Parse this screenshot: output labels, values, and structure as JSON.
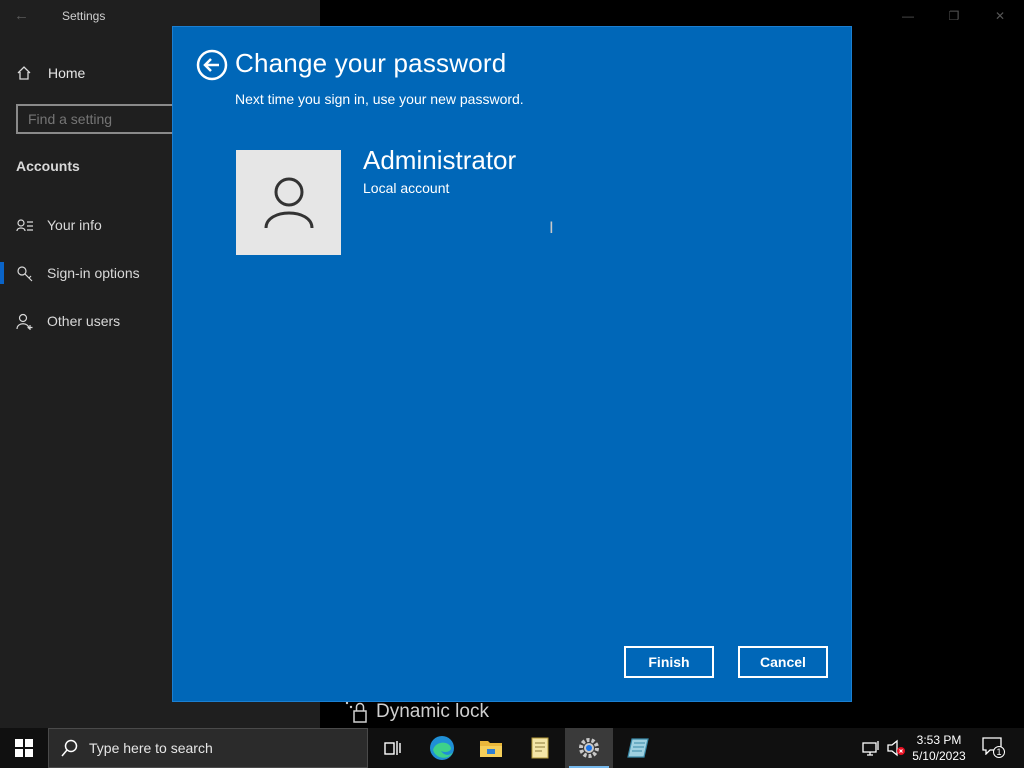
{
  "window": {
    "title": "Settings",
    "controls": [
      "minimize-icon",
      "maximize-icon",
      "close-icon"
    ]
  },
  "sidebar": {
    "home_label": "Home",
    "search_placeholder": "Find a setting",
    "section": "Accounts",
    "items": [
      {
        "label": "Your info",
        "icon": "person-card-icon",
        "selected": false
      },
      {
        "label": "Sign-in options",
        "icon": "key-icon",
        "selected": true
      },
      {
        "label": "Other users",
        "icon": "person-add-icon",
        "selected": false
      }
    ]
  },
  "background_content": {
    "dynamic_lock_label": "Dynamic lock"
  },
  "dialog": {
    "title": "Change your password",
    "subtitle": "Next time you sign in, use your new password.",
    "account_name": "Administrator",
    "account_type": "Local account",
    "finish_label": "Finish",
    "cancel_label": "Cancel"
  },
  "taskbar": {
    "search_placeholder": "Type here to search",
    "apps": [
      "task-view-icon",
      "edge-icon",
      "file-explorer-icon",
      "notepad-icon",
      "settings-gear-icon",
      "app-icon"
    ],
    "time": "3:53 PM",
    "date": "5/10/2023",
    "notification_count": "1"
  },
  "colors": {
    "dialog_blue": "#0067b8",
    "sidebar": "#1f1f1f",
    "accent": "#0a64c8"
  }
}
